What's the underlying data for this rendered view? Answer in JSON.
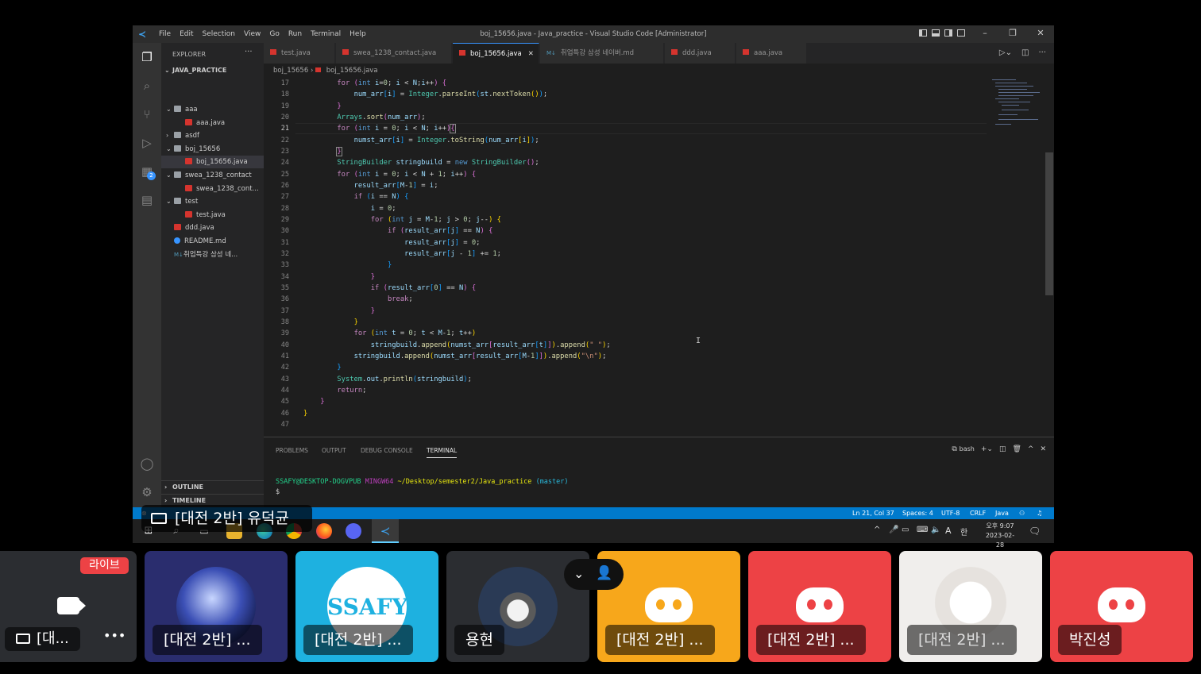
{
  "window": {
    "title": "boj_15656.java - Java_practice - Visual Studio Code [Administrator]",
    "menu": [
      "File",
      "Edit",
      "Selection",
      "View",
      "Go",
      "Run",
      "Terminal",
      "Help"
    ]
  },
  "sidebar": {
    "header": "EXPLORER",
    "project": "JAVA_PRACTICE",
    "tree": [
      {
        "label": "aaa",
        "type": "folder",
        "open": true,
        "depth": 0
      },
      {
        "label": "aaa.java",
        "type": "java",
        "depth": 1
      },
      {
        "label": "asdf",
        "type": "folder",
        "open": false,
        "depth": 0
      },
      {
        "label": "boj_15656",
        "type": "folder",
        "open": true,
        "depth": 0
      },
      {
        "label": "boj_15656.java",
        "type": "java",
        "depth": 1,
        "selected": true
      },
      {
        "label": "swea_1238_contact",
        "type": "folder",
        "open": true,
        "depth": 0
      },
      {
        "label": "swea_1238_cont...",
        "type": "java",
        "depth": 1
      },
      {
        "label": "test",
        "type": "folder",
        "open": true,
        "depth": 0
      },
      {
        "label": "test.java",
        "type": "java",
        "depth": 1
      },
      {
        "label": "ddd.java",
        "type": "java",
        "depth": 0
      },
      {
        "label": "README.md",
        "type": "info",
        "depth": 0
      },
      {
        "label": "취업특강 삼성 네...",
        "type": "md",
        "depth": 0
      }
    ],
    "outline": "OUTLINE",
    "timeline": "TIMELINE"
  },
  "tabs": [
    {
      "label": "test.java",
      "type": "java"
    },
    {
      "label": "swea_1238_contact.java",
      "type": "java"
    },
    {
      "label": "boj_15656.java",
      "type": "java",
      "active": true
    },
    {
      "label": "취업특강 삼성 네이버.md",
      "type": "md"
    },
    {
      "label": "ddd.java",
      "type": "java"
    },
    {
      "label": "aaa.java",
      "type": "java"
    }
  ],
  "breadcrumb": {
    "folder": "boj_15656",
    "file": "boj_15656.java"
  },
  "editor": {
    "current_line": 21,
    "lines": [
      17,
      18,
      19,
      20,
      21,
      22,
      23,
      24,
      25,
      26,
      27,
      28,
      29,
      30,
      31,
      32,
      33,
      34,
      35,
      36,
      37,
      38,
      39,
      40,
      41,
      42,
      43,
      44,
      45,
      46,
      47
    ]
  },
  "panel": {
    "tabs": [
      "PROBLEMS",
      "OUTPUT",
      "DEBUG CONSOLE",
      "TERMINAL"
    ],
    "active": "TERMINAL",
    "shell": "bash",
    "prompt_user": "SSAFY@DESKTOP-DOGVPUB",
    "prompt_env": "MINGW64",
    "prompt_path": "~/Desktop/semester2/Java_practice",
    "prompt_branch": "(master)",
    "prompt_symbol": "$"
  },
  "status": {
    "position": "Ln 21, Col 37",
    "spaces": "Spaces: 4",
    "encoding": "UTF-8",
    "eol": "CRLF",
    "language": "Java"
  },
  "taskbar": {
    "time": "오후 9:07",
    "date": "2023-02-28",
    "ime": "A"
  },
  "call": {
    "sharer": "[대전 2반] 유덕균",
    "live_badge": "라이브",
    "tiles": [
      {
        "label": "[대...",
        "kind": "stream"
      },
      {
        "label": "[대전 2반] ...",
        "kind": "avatar-blue"
      },
      {
        "label": "[대전 2반] ...",
        "kind": "ssafy"
      },
      {
        "label": "용현",
        "kind": "cat"
      },
      {
        "label": "[대전 2반] ...",
        "kind": "discord-orange"
      },
      {
        "label": "[대전 2반] ...",
        "kind": "discord-red"
      },
      {
        "label": "[대전 2반] ...",
        "kind": "illustration"
      },
      {
        "label": "박진성",
        "kind": "discord-red"
      }
    ],
    "ssafy_text": "SSAFY"
  },
  "colors": {
    "accent": "#007acc",
    "discord_red": "#ed4245",
    "discord_orange": "#f7a71b",
    "ssafy_blue": "#1eb1e0"
  }
}
